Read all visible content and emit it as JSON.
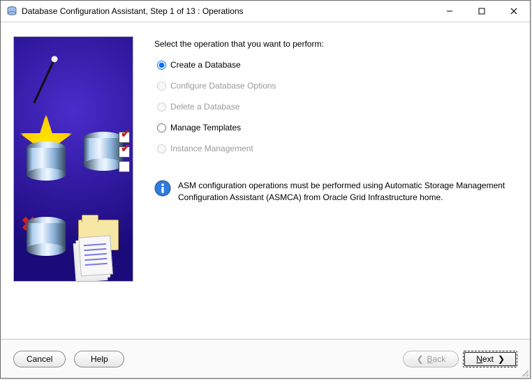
{
  "window": {
    "title": "Database Configuration Assistant, Step 1 of 13 : Operations"
  },
  "main": {
    "prompt": "Select the operation that you want to perform:",
    "options": [
      {
        "label": "Create a Database",
        "selected": true,
        "enabled": true
      },
      {
        "label": "Configure Database Options",
        "selected": false,
        "enabled": false
      },
      {
        "label": "Delete a Database",
        "selected": false,
        "enabled": false
      },
      {
        "label": "Manage Templates",
        "selected": false,
        "enabled": true
      },
      {
        "label": "Instance Management",
        "selected": false,
        "enabled": false
      }
    ],
    "info": "ASM configuration operations must be performed using Automatic Storage Management Configuration Assistant (ASMCA) from Oracle Grid Infrastructure home."
  },
  "footer": {
    "cancel": "Cancel",
    "help": "Help",
    "back": "Back",
    "next": "Next"
  }
}
